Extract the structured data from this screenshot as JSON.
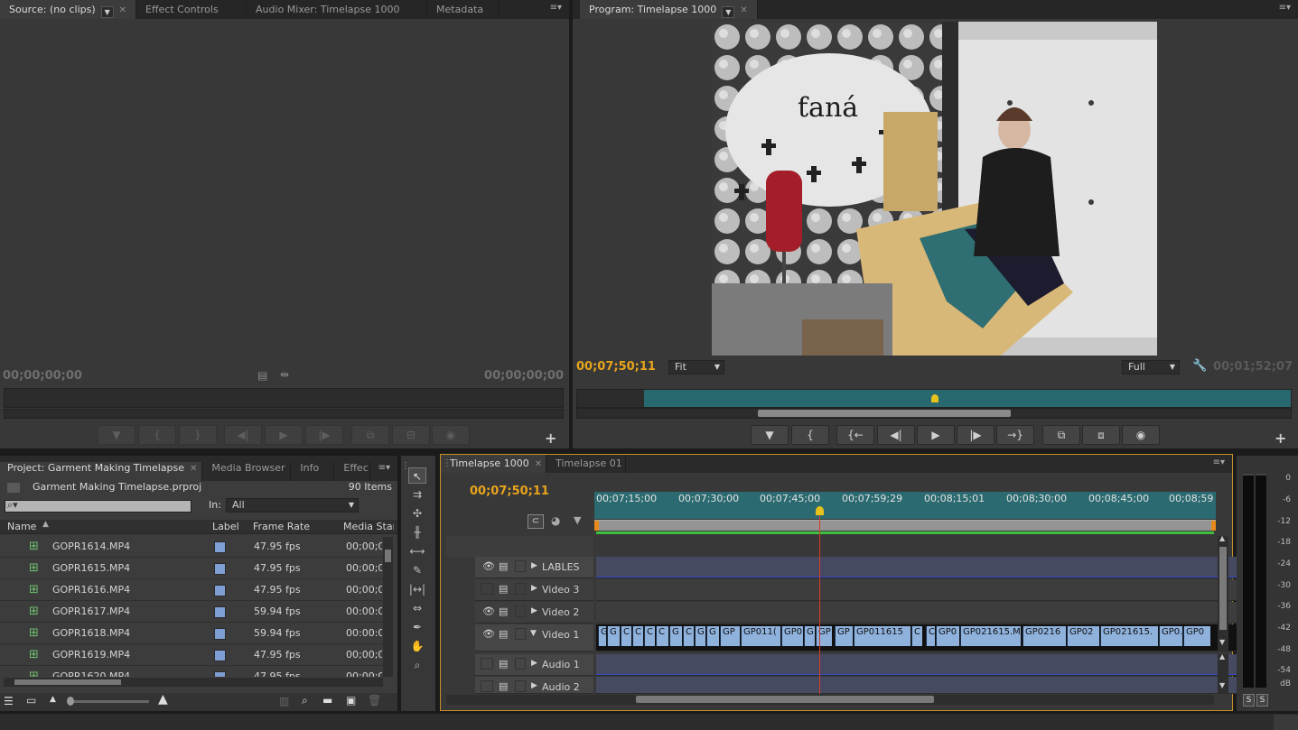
{
  "source": {
    "tabs": [
      "Source: (no clips)",
      "Effect Controls",
      "Audio Mixer: Timelapse 1000",
      "Metadata"
    ],
    "tc_in": "00;00;00;00",
    "tc_out": "00;00;00;00"
  },
  "program": {
    "tab": "Program: Timelapse 1000",
    "tc_current": "00;07;50;11",
    "zoom": "Fit",
    "quality": "Full",
    "tc_duration": "00;01;52;07"
  },
  "project": {
    "tabs": [
      "Project: Garment Making Timelapse",
      "Media Browser",
      "Info",
      "Effec"
    ],
    "filename": "Garment Making Timelapse.prproj",
    "item_count": "90 Items",
    "in_label": "In:",
    "in_value": "All",
    "columns": [
      "Name",
      "Label",
      "Frame Rate",
      "Media Star"
    ],
    "rows": [
      {
        "name": "GOPR1614.MP4",
        "fps": "47.95 fps",
        "start": "00;00;0"
      },
      {
        "name": "GOPR1615.MP4",
        "fps": "47.95 fps",
        "start": "00;00;0"
      },
      {
        "name": "GOPR1616.MP4",
        "fps": "47.95 fps",
        "start": "00;00;0"
      },
      {
        "name": "GOPR1617.MP4",
        "fps": "59.94 fps",
        "start": "00:00:0"
      },
      {
        "name": "GOPR1618.MP4",
        "fps": "59.94 fps",
        "start": "00:00:0"
      },
      {
        "name": "GOPR1619.MP4",
        "fps": "47.95 fps",
        "start": "00;00;0"
      },
      {
        "name": "GOPR1620.MP4",
        "fps": "47.95 fps",
        "start": "00;00;0"
      }
    ]
  },
  "timeline": {
    "tabs": [
      "Timelapse 1000",
      "Timelapse 01"
    ],
    "tc_current": "00;07;50;11",
    "ruler": [
      "00;07;15;00",
      "00;07;30;00",
      "00;07;45;00",
      "00;07;59;29",
      "00;08;15;01",
      "00;08;30;00",
      "00;08;45;00",
      "00;08;59;"
    ],
    "tracks": [
      {
        "name": "LABLES"
      },
      {
        "name": "Video 3"
      },
      {
        "name": "Video 2"
      },
      {
        "name": "Video 1"
      },
      {
        "name": "Audio 1"
      },
      {
        "name": "Audio 2"
      }
    ],
    "clips": [
      "G",
      "G",
      "C",
      "C",
      "C",
      "C",
      "G",
      "C",
      "G",
      "G",
      "GP",
      "GP011(",
      "GP0",
      "G",
      "GP",
      "GP",
      "GP011615",
      "C",
      "C",
      "GP0",
      "GP021615.M",
      "GP0216",
      "GP02",
      "GP021615.",
      "GP0.",
      "GP0"
    ]
  },
  "meter": {
    "labels": [
      "0",
      "-6",
      "-12",
      "-18",
      "-24",
      "-30",
      "-36",
      "-42",
      "-48",
      "-54",
      "dB"
    ],
    "solo": [
      "S",
      "S"
    ]
  },
  "colors": {
    "accent_timecode": "#e8a41c",
    "clip_blue": "#8fb2dd",
    "label_swatch": "#7f9fd4",
    "panel_focus": "#c5902a"
  }
}
